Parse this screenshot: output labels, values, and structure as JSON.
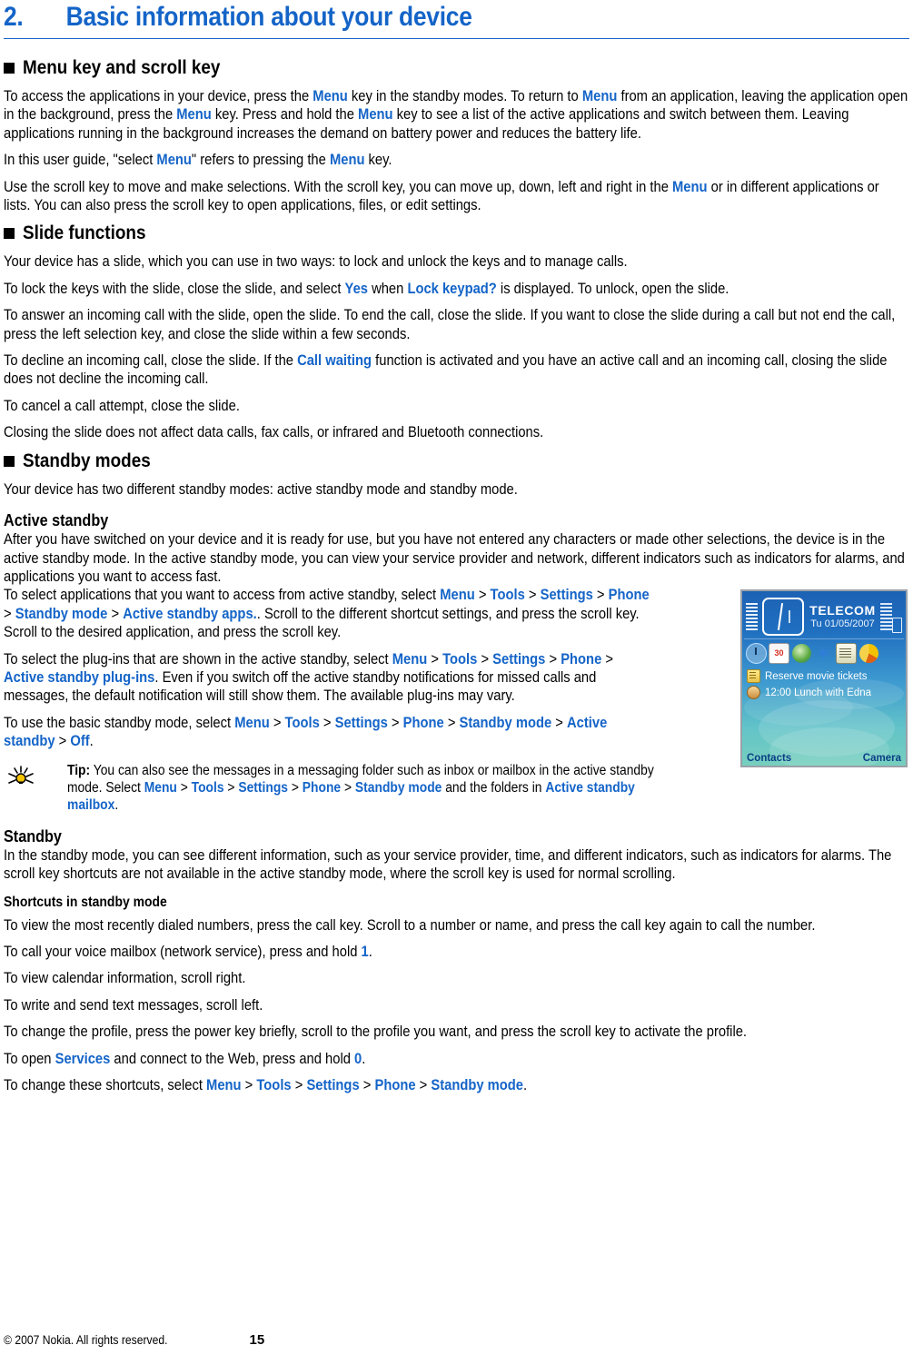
{
  "chapter": {
    "number": "2.",
    "title": "Basic information about your device"
  },
  "sections": [
    {
      "heading": "Menu key and scroll key",
      "paragraphs": [
        "To access the applications in your device, press the |Menu| key in the standby modes. To return to |Menu| from an application, leaving the application open in the background, press the |Menu| key. Press and hold the |Menu| key to see a list of the active applications and switch between them. Leaving applications running in the background increases the demand on battery power and reduces the battery life.",
        "In this user guide, \"select |Menu|\" refers to pressing the |Menu| key.",
        "Use the scroll key to move and make selections. With the scroll key, you can move up, down, left and right in the |Menu| or in different applications or lists. You can also press the scroll key to open applications, files, or edit settings."
      ]
    },
    {
      "heading": "Slide functions",
      "paragraphs": [
        "Your device has a slide, which you can use in two ways: to lock and unlock the keys and to manage calls.",
        "To lock the keys with the slide, close the slide, and select |Yes| when |Lock keypad?| is displayed. To unlock, open the slide.",
        "To answer an incoming call with the slide, open the slide. To end the call, close the slide. If you want to close the slide during a call but not end the call, press the left selection key, and close the slide within a few seconds.",
        "To decline an incoming call, close the slide. If the |Call waiting| function is activated and you have an active call and an incoming call, closing the slide does not decline the incoming call.",
        "To cancel a call attempt, close the slide.",
        "Closing the slide does not affect data calls, fax calls, or infrared and Bluetooth connections."
      ]
    },
    {
      "heading": "Standby modes",
      "intro": "Your device has two different standby modes: active standby mode and standby mode.",
      "active_standby": {
        "subheading": "Active standby",
        "paragraphs": [
          "After you have switched on your device and it is ready for use, but you have not entered any characters or made other selections, the device is in the active standby mode. In the active standby mode, you can view your service provider and network, different indicators such as indicators for alarms, and applications you want to access fast.",
          "To select applications that you want to access from active standby, select |Menu| > |Tools| > |Settings| > |Phone| > |Standby mode| > |Active standby apps.|. Scroll to the different shortcut settings, and press the scroll key. Scroll to the desired application, and press the scroll key.",
          "To select the plug-ins that are shown in the active standby, select |Menu| > |Tools| > |Settings| > |Phone| > |Active standby plug-ins|. Even if you switch off the active standby notifications for missed calls and messages, the default notification will still show them. The available plug-ins may vary.",
          "To use the basic standby mode, select |Menu| > |Tools| > |Settings| > |Phone| > |Standby mode| > |Active standby| > |Off|."
        ]
      },
      "tip": {
        "label": "Tip:",
        "text": " You can also see the messages in a messaging folder such as inbox or mailbox in the active standby mode. Select |Menu| > |Tools| > |Settings| > |Phone| > |Standby mode| and the folders in |Active standby mailbox|."
      },
      "standby": {
        "subheading": "Standby",
        "paragraphs": [
          "In the standby mode, you can see different information, such as your service provider, time, and different indicators, such as indicators for alarms. The scroll key shortcuts are not available in the active standby mode, where the scroll key is used for normal scrolling."
        ],
        "shortcuts_heading": "Shortcuts in standby mode",
        "shortcuts": [
          "To view the most recently dialed numbers, press the call key. Scroll to a number or name, and press the call key again to call the number.",
          "To call your voice mailbox (network service), press and hold |1|.",
          "To view calendar information, scroll right.",
          "To write and send text messages, scroll left.",
          "To change the profile, press the power key briefly, scroll to the profile you want, and press the scroll key to activate the profile.",
          "To open |Services| and connect to the Web, press and hold |0|.",
          "To change these shortcuts, select |Menu| > |Tools| > |Settings| > |Phone| > |Standby mode|."
        ]
      }
    }
  ],
  "phone_screen": {
    "operator": "TELECOM",
    "date": "Tu 01/05/2007",
    "icons": [
      "clock-icon",
      "calendar-icon",
      "web-icon",
      "bluetooth-icon",
      "notes-icon",
      "gallery-icon"
    ],
    "calendar_day": "30",
    "items": [
      {
        "icon": "note-icon",
        "text": "Reserve movie tickets"
      },
      {
        "icon": "meeting-icon",
        "text": "12:00 Lunch with Edna"
      }
    ],
    "softkey_left": "Contacts",
    "softkey_right": "Camera"
  },
  "footer": {
    "copyright": "© 2007 Nokia. All rights reserved.",
    "page_number": "15"
  },
  "colors": {
    "accent": "#1464c8",
    "text": "#000000"
  }
}
